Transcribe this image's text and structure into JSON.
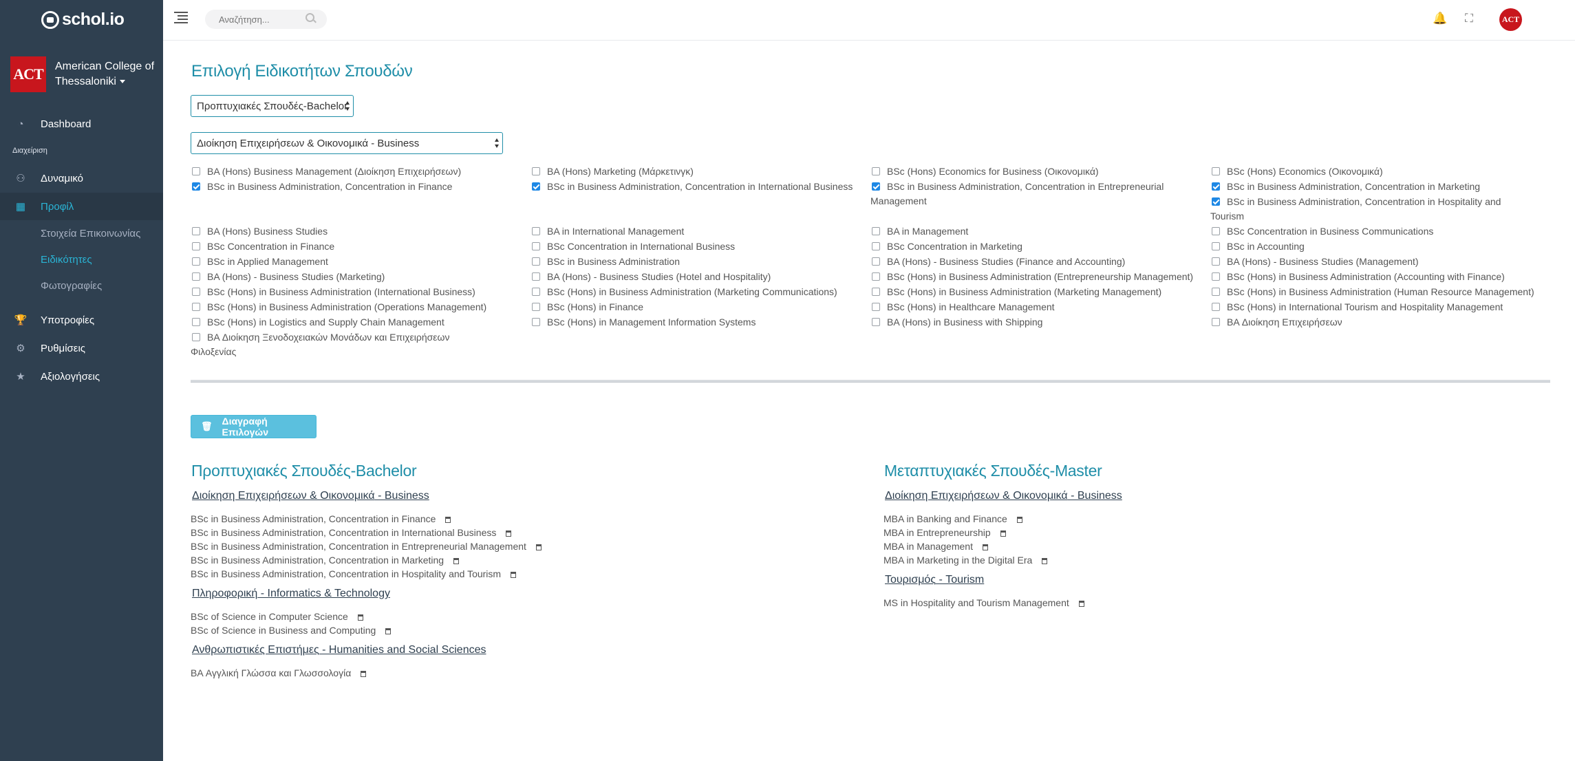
{
  "brand": {
    "name": "schol.io"
  },
  "org": {
    "line1": "American College of",
    "line2": "Thessaloniki",
    "logo_text": "ACT"
  },
  "sidebar": {
    "dashboard": "Dashboard",
    "section_label": "Διαχείριση",
    "items": [
      {
        "label": "Δυναμικό",
        "icon": "user-icon"
      },
      {
        "label": "Προφίλ",
        "icon": "grid-icon"
      },
      {
        "label": "Υποτροφίες",
        "icon": "trophy-icon"
      },
      {
        "label": "Ρυθμίσεις",
        "icon": "gears-icon"
      },
      {
        "label": "Αξιολογήσεις",
        "icon": "star-icon"
      }
    ],
    "sub_items": [
      "Στοιχεία Επικοινωνίας",
      "Ειδικότητες",
      "Φωτογραφίες"
    ]
  },
  "topbar": {
    "search_placeholder": "Αναζήτηση...",
    "avatar_text": "ACT"
  },
  "page": {
    "title": "Επιλογή Ειδικοτήτων Σπουδών",
    "level_select": "Προπτυχιακές Σπουδές-Bachelor",
    "field_select": "Διοίκηση Επιχειρήσεων & Οικονομικά - Business",
    "delete_button": "Διαγραφή Επιλογών"
  },
  "checkboxes": [
    {
      "label": "BA (Hons) Business Management (Διοίκηση Επιχειρήσεων)",
      "checked": false
    },
    {
      "label": "BA (Hons) Marketing (Μάρκετινγκ)",
      "checked": false
    },
    {
      "label": "BSc (Hons) Economics for Business (Οικονομικά)",
      "checked": false
    },
    {
      "label": "BSc (Hons) Economics (Οικονομικά)",
      "checked": false
    },
    {
      "label": "BSc in Business Administration, Concentration in Finance",
      "checked": true
    },
    {
      "label": "BSc in Business Administration, Concentration in International Business",
      "checked": true
    },
    {
      "label": "BSc in Business Administration, Concentration in Entrepreneurial Management",
      "checked": true
    },
    {
      "label": "BSc in Business Administration, Concentration in Marketing",
      "checked": true
    },
    {
      "label": "BSc in Business Administration, Concentration in Hospitality and Tourism",
      "checked": true
    },
    {
      "label": "BA (Hons) Business Studies",
      "checked": false
    },
    {
      "label": "BA in International Management",
      "checked": false
    },
    {
      "label": "BA in Management",
      "checked": false
    },
    {
      "label": "BSc Concentration in Business Communications",
      "checked": false
    },
    {
      "label": "BSc Concentration in Finance",
      "checked": false
    },
    {
      "label": "BSc Concentration in International Business",
      "checked": false
    },
    {
      "label": "BSc Concentration in Marketing",
      "checked": false
    },
    {
      "label": "BSc in Accounting",
      "checked": false
    },
    {
      "label": "BSc in Applied Management",
      "checked": false
    },
    {
      "label": "BSc in Business Administration",
      "checked": false
    },
    {
      "label": "BA (Hons) - Business Studies (Finance and Accounting)",
      "checked": false
    },
    {
      "label": "BA (Hons) - Business Studies (Management)",
      "checked": false
    },
    {
      "label": "BA (Hons) - Business Studies (Marketing)",
      "checked": false
    },
    {
      "label": "BA (Hons) - Business Studies (Hotel and Hospitality)",
      "checked": false
    },
    {
      "label": "BSc (Hons) in Business Administration (Entrepreneurship Management)",
      "checked": false
    },
    {
      "label": "BSc (Hons) in Business Administration (Accounting with Finance)",
      "checked": false
    },
    {
      "label": "BSc (Hons) in Business Administration (International Business)",
      "checked": false
    },
    {
      "label": "BSc (Hons) in Business Administration (Marketing Communications)",
      "checked": false
    },
    {
      "label": "BSc (Hons) in Business Administration (Marketing Management)",
      "checked": false
    },
    {
      "label": "BSc (Hons) in Business Administration (Human Resource Management)",
      "checked": false
    },
    {
      "label": "BSc (Hons) in Business Administration (Operations Management)",
      "checked": false
    },
    {
      "label": "BSc (Hons) in Finance",
      "checked": false
    },
    {
      "label": "BSc (Hons) in Healthcare Management",
      "checked": false
    },
    {
      "label": "BSc (Hons) in International Tourism and Hospitality Management",
      "checked": false
    },
    {
      "label": "BSc (Hons) in Logistics and Supply Chain Management",
      "checked": false
    },
    {
      "label": "BSc (Hons) in Management Information Systems",
      "checked": false
    },
    {
      "label": "BA (Hons) in Business with Shipping",
      "checked": false
    },
    {
      "label": "BA Διοίκηση Επιχειρήσεων",
      "checked": false
    },
    {
      "label": "BA Διοίκηση Ξενοδοχειακών Μονάδων και Επιχειρήσεων Φιλοξενίας",
      "checked": false
    }
  ],
  "summary": {
    "bachelor": {
      "title_a": "Προπτυχιακές Σπουδές",
      "title_b": "-Bachelor",
      "groups": [
        {
          "name_a": "Διοίκηση Επιχειρήσεων & Οικονομικά",
          "name_b": " - Business",
          "items": [
            "BSc in Business Administration, Concentration in Finance",
            "BSc in Business Administration, Concentration in International Business",
            "BSc in Business Administration, Concentration in Entrepreneurial Management",
            "BSc in Business Administration, Concentration in Marketing",
            "BSc in Business Administration, Concentration in Hospitality and Tourism"
          ]
        },
        {
          "name_a": "Πληροφορική",
          "name_b": " - Informatics & Technology",
          "items": [
            "BSc of Science in Computer Science",
            "BSc of Science in Business and Computing"
          ]
        },
        {
          "name_a": "Ανθρωπιστικές Επιστήμες",
          "name_b": " - Humanities and Social Sciences",
          "items": [
            "BA Αγγλική Γλώσσα και Γλωσσολογία"
          ]
        }
      ]
    },
    "master": {
      "title_a": "Μεταπτυχιακές Σπουδές",
      "title_b": "-Master",
      "groups": [
        {
          "name_a": "Διοίκηση Επιχειρήσεων & Οικονομικά",
          "name_b": " - Business",
          "items": [
            "MBA in Banking and Finance",
            "MBA in Entrepreneurship",
            "MBA in Management",
            "MBA in Marketing in the Digital Era"
          ]
        },
        {
          "name_a": "Τουρισμός",
          "name_b": " - Tourism",
          "items": [
            "MS in Hospitality and Tourism Management"
          ]
        }
      ]
    }
  }
}
